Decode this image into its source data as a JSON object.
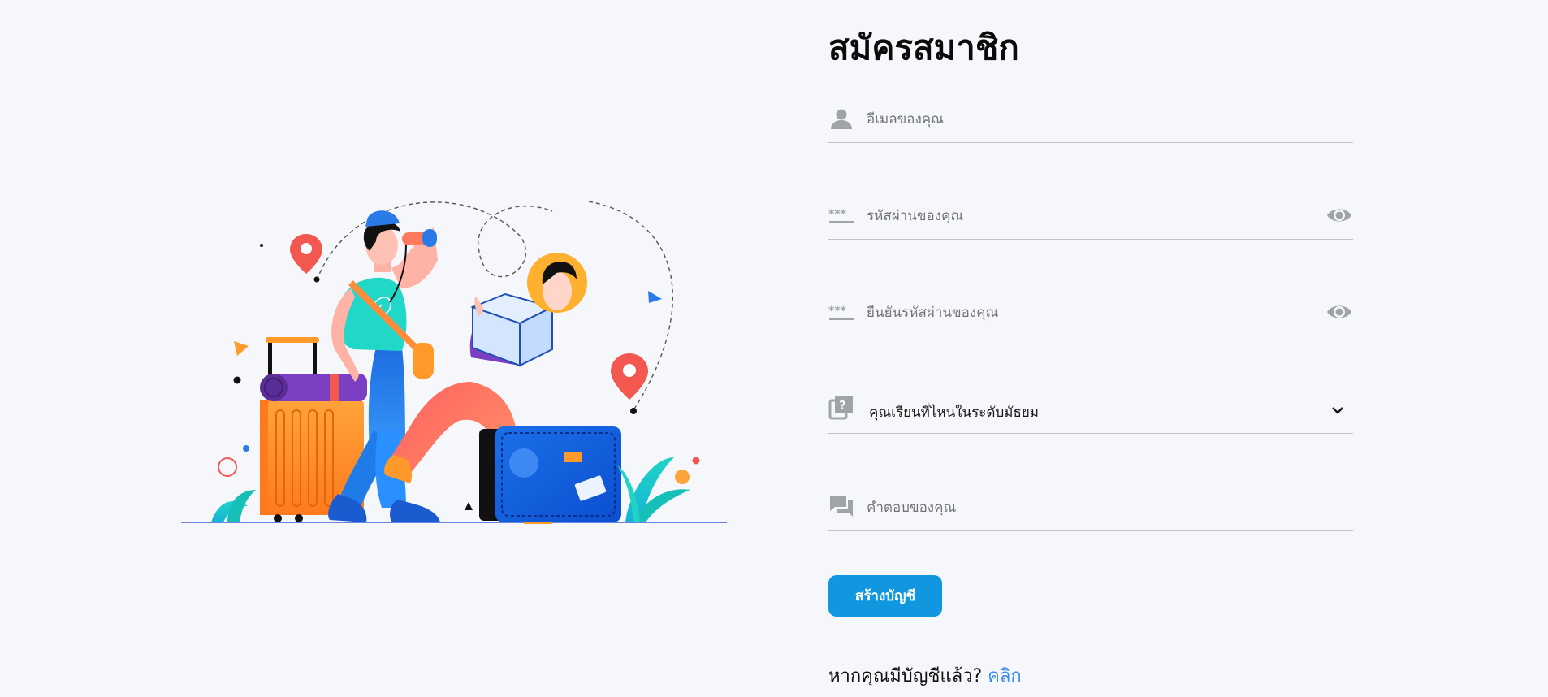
{
  "page": {
    "title": "สมัครสมาชิก",
    "illustration": "travelers-with-luggage-illustration"
  },
  "form": {
    "email": {
      "placeholder": "อีเมลของคุณ",
      "value": "",
      "icon": "person-icon"
    },
    "password": {
      "placeholder": "รหัสผ่านของคุณ",
      "value": "",
      "icon": "password-dots-icon",
      "toggle_icon": "eye-icon"
    },
    "confirm_password": {
      "placeholder": "ยืนยันรหัสผ่านของคุณ",
      "value": "",
      "icon": "password-dots-icon",
      "toggle_icon": "eye-icon"
    },
    "school": {
      "label": "คุณเรียนที่ไหนในระดับมัธยม",
      "icon": "question-cards-icon",
      "dropdown_icon": "chevron-down-icon"
    },
    "answer": {
      "placeholder": "คำตอบของคุณ",
      "value": "",
      "icon": "chat-bubbles-icon"
    },
    "submit_label": "สร้างบัญชี",
    "signin_prompt": "หากคุณมีบัญชีแล้ว?",
    "signin_link": "คลิก"
  },
  "colors": {
    "background": "#f6f7fb",
    "accent": "#1196e0",
    "link": "#3a8ee6",
    "icon_gray": "#a0a4a9",
    "divider": "#bfc3c9"
  }
}
